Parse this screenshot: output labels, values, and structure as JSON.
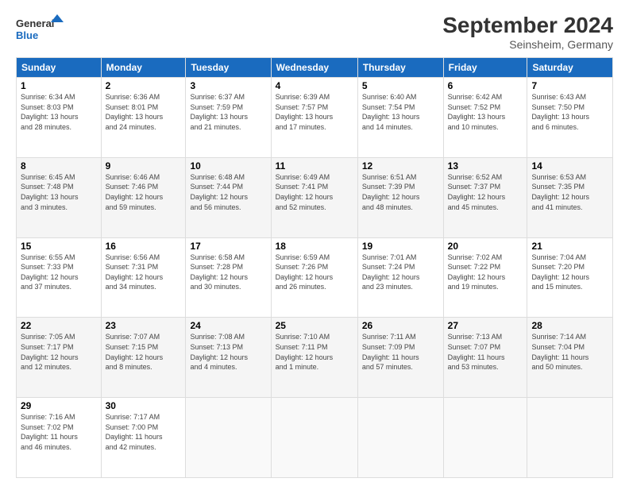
{
  "header": {
    "logo_line1": "General",
    "logo_line2": "Blue",
    "main_title": "September 2024",
    "subtitle": "Seinsheim, Germany"
  },
  "weekdays": [
    "Sunday",
    "Monday",
    "Tuesday",
    "Wednesday",
    "Thursday",
    "Friday",
    "Saturday"
  ],
  "weeks": [
    [
      {
        "day": "1",
        "info": "Sunrise: 6:34 AM\nSunset: 8:03 PM\nDaylight: 13 hours\nand 28 minutes."
      },
      {
        "day": "2",
        "info": "Sunrise: 6:36 AM\nSunset: 8:01 PM\nDaylight: 13 hours\nand 24 minutes."
      },
      {
        "day": "3",
        "info": "Sunrise: 6:37 AM\nSunset: 7:59 PM\nDaylight: 13 hours\nand 21 minutes."
      },
      {
        "day": "4",
        "info": "Sunrise: 6:39 AM\nSunset: 7:57 PM\nDaylight: 13 hours\nand 17 minutes."
      },
      {
        "day": "5",
        "info": "Sunrise: 6:40 AM\nSunset: 7:54 PM\nDaylight: 13 hours\nand 14 minutes."
      },
      {
        "day": "6",
        "info": "Sunrise: 6:42 AM\nSunset: 7:52 PM\nDaylight: 13 hours\nand 10 minutes."
      },
      {
        "day": "7",
        "info": "Sunrise: 6:43 AM\nSunset: 7:50 PM\nDaylight: 13 hours\nand 6 minutes."
      }
    ],
    [
      {
        "day": "8",
        "info": "Sunrise: 6:45 AM\nSunset: 7:48 PM\nDaylight: 13 hours\nand 3 minutes."
      },
      {
        "day": "9",
        "info": "Sunrise: 6:46 AM\nSunset: 7:46 PM\nDaylight: 12 hours\nand 59 minutes."
      },
      {
        "day": "10",
        "info": "Sunrise: 6:48 AM\nSunset: 7:44 PM\nDaylight: 12 hours\nand 56 minutes."
      },
      {
        "day": "11",
        "info": "Sunrise: 6:49 AM\nSunset: 7:41 PM\nDaylight: 12 hours\nand 52 minutes."
      },
      {
        "day": "12",
        "info": "Sunrise: 6:51 AM\nSunset: 7:39 PM\nDaylight: 12 hours\nand 48 minutes."
      },
      {
        "day": "13",
        "info": "Sunrise: 6:52 AM\nSunset: 7:37 PM\nDaylight: 12 hours\nand 45 minutes."
      },
      {
        "day": "14",
        "info": "Sunrise: 6:53 AM\nSunset: 7:35 PM\nDaylight: 12 hours\nand 41 minutes."
      }
    ],
    [
      {
        "day": "15",
        "info": "Sunrise: 6:55 AM\nSunset: 7:33 PM\nDaylight: 12 hours\nand 37 minutes."
      },
      {
        "day": "16",
        "info": "Sunrise: 6:56 AM\nSunset: 7:31 PM\nDaylight: 12 hours\nand 34 minutes."
      },
      {
        "day": "17",
        "info": "Sunrise: 6:58 AM\nSunset: 7:28 PM\nDaylight: 12 hours\nand 30 minutes."
      },
      {
        "day": "18",
        "info": "Sunrise: 6:59 AM\nSunset: 7:26 PM\nDaylight: 12 hours\nand 26 minutes."
      },
      {
        "day": "19",
        "info": "Sunrise: 7:01 AM\nSunset: 7:24 PM\nDaylight: 12 hours\nand 23 minutes."
      },
      {
        "day": "20",
        "info": "Sunrise: 7:02 AM\nSunset: 7:22 PM\nDaylight: 12 hours\nand 19 minutes."
      },
      {
        "day": "21",
        "info": "Sunrise: 7:04 AM\nSunset: 7:20 PM\nDaylight: 12 hours\nand 15 minutes."
      }
    ],
    [
      {
        "day": "22",
        "info": "Sunrise: 7:05 AM\nSunset: 7:17 PM\nDaylight: 12 hours\nand 12 minutes."
      },
      {
        "day": "23",
        "info": "Sunrise: 7:07 AM\nSunset: 7:15 PM\nDaylight: 12 hours\nand 8 minutes."
      },
      {
        "day": "24",
        "info": "Sunrise: 7:08 AM\nSunset: 7:13 PM\nDaylight: 12 hours\nand 4 minutes."
      },
      {
        "day": "25",
        "info": "Sunrise: 7:10 AM\nSunset: 7:11 PM\nDaylight: 12 hours\nand 1 minute."
      },
      {
        "day": "26",
        "info": "Sunrise: 7:11 AM\nSunset: 7:09 PM\nDaylight: 11 hours\nand 57 minutes."
      },
      {
        "day": "27",
        "info": "Sunrise: 7:13 AM\nSunset: 7:07 PM\nDaylight: 11 hours\nand 53 minutes."
      },
      {
        "day": "28",
        "info": "Sunrise: 7:14 AM\nSunset: 7:04 PM\nDaylight: 11 hours\nand 50 minutes."
      }
    ],
    [
      {
        "day": "29",
        "info": "Sunrise: 7:16 AM\nSunset: 7:02 PM\nDaylight: 11 hours\nand 46 minutes."
      },
      {
        "day": "30",
        "info": "Sunrise: 7:17 AM\nSunset: 7:00 PM\nDaylight: 11 hours\nand 42 minutes."
      },
      null,
      null,
      null,
      null,
      null
    ]
  ]
}
